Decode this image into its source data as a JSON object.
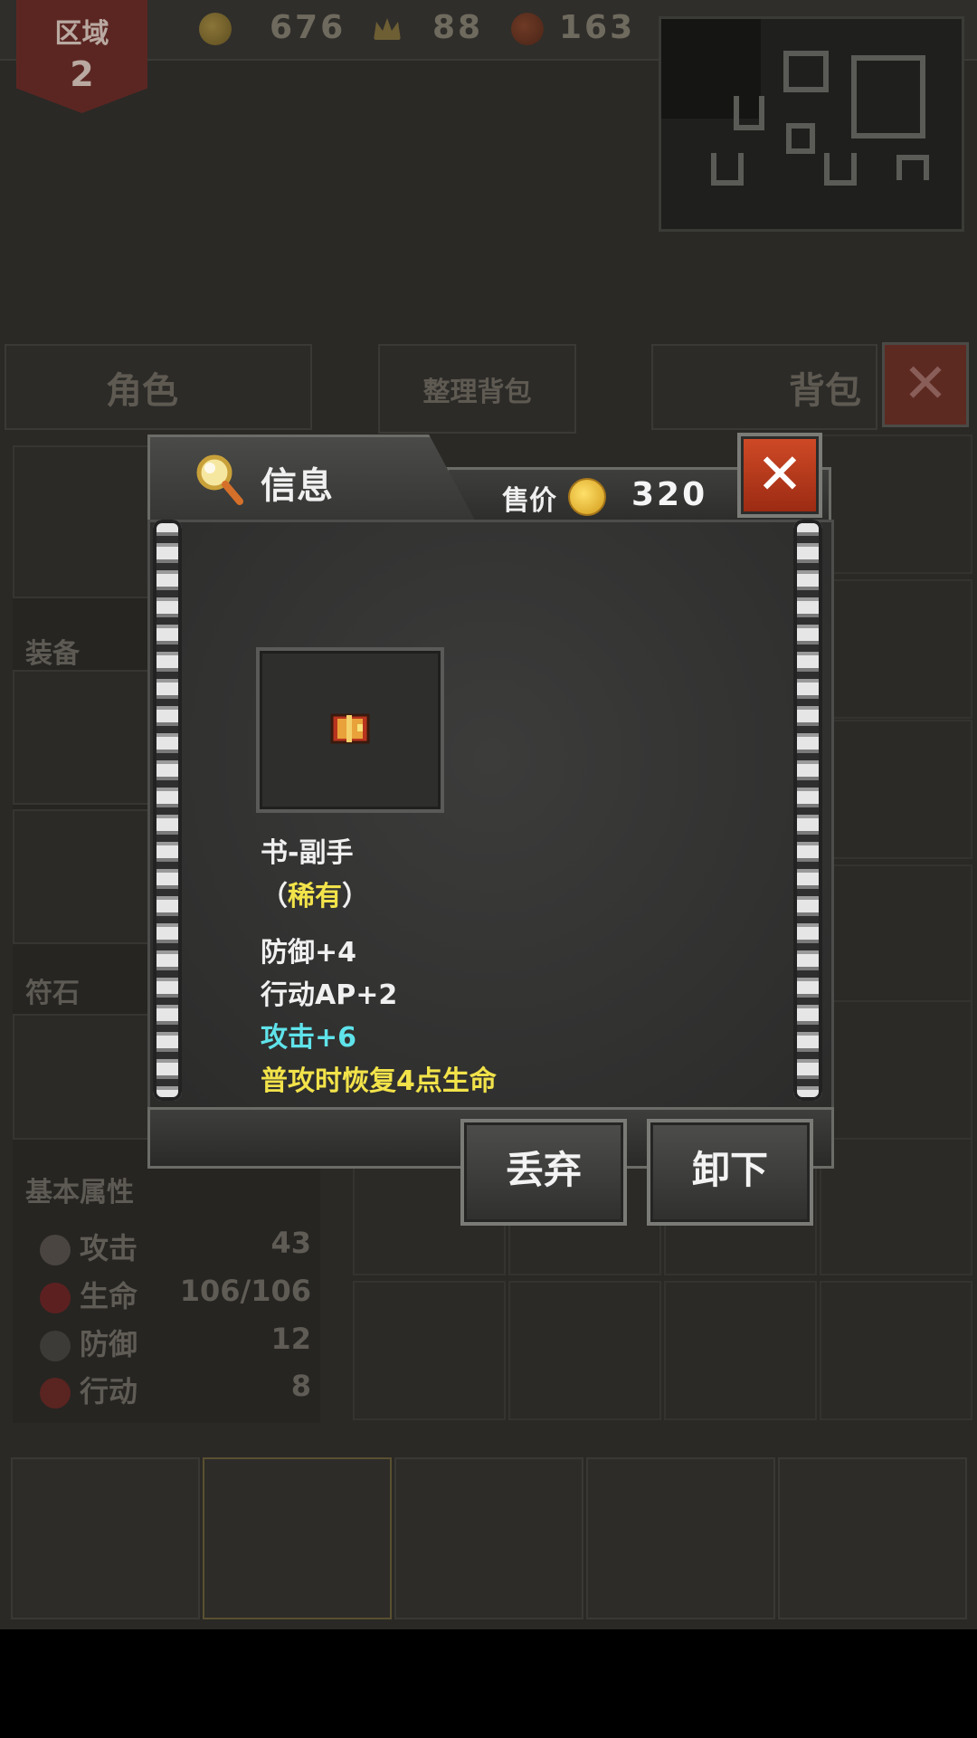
{
  "hud": {
    "region_label": "区域",
    "region_number": "2",
    "coins": "676",
    "crowns": "88",
    "meat": "163"
  },
  "tabs": {
    "character": "角色",
    "sort_bag": "整理背包",
    "bag": "背包"
  },
  "left_panel": {
    "equipment_title": "装备",
    "rune_title": "符石",
    "attributes_title": "基本属性",
    "attributes": [
      {
        "name": "攻击",
        "value": "43"
      },
      {
        "name": "生命",
        "value": "106/106"
      },
      {
        "name": "防御",
        "value": "12"
      },
      {
        "name": "行动",
        "value": "8"
      }
    ]
  },
  "modal": {
    "title": "信息",
    "price_label": "售价",
    "price_value": "320",
    "item_name": "书-副手",
    "rarity_open": "（",
    "rarity": "稀有",
    "rarity_close": "）",
    "stats": [
      {
        "text": "防御+4",
        "color": "#f0f0f0"
      },
      {
        "text": "行动AP+2",
        "color": "#f0f0f0"
      },
      {
        "text": "攻击+6",
        "color": "#5fe3ea"
      },
      {
        "text": "普攻时恢复4点生命",
        "color": "#f2e34a"
      }
    ],
    "discard_label": "丢弃",
    "unequip_label": "卸下",
    "close_label": "✕"
  },
  "colors": {
    "rarity": "#f2e34a",
    "bonus_attack": "#5fe3ea",
    "close_button": "#c2411f"
  }
}
